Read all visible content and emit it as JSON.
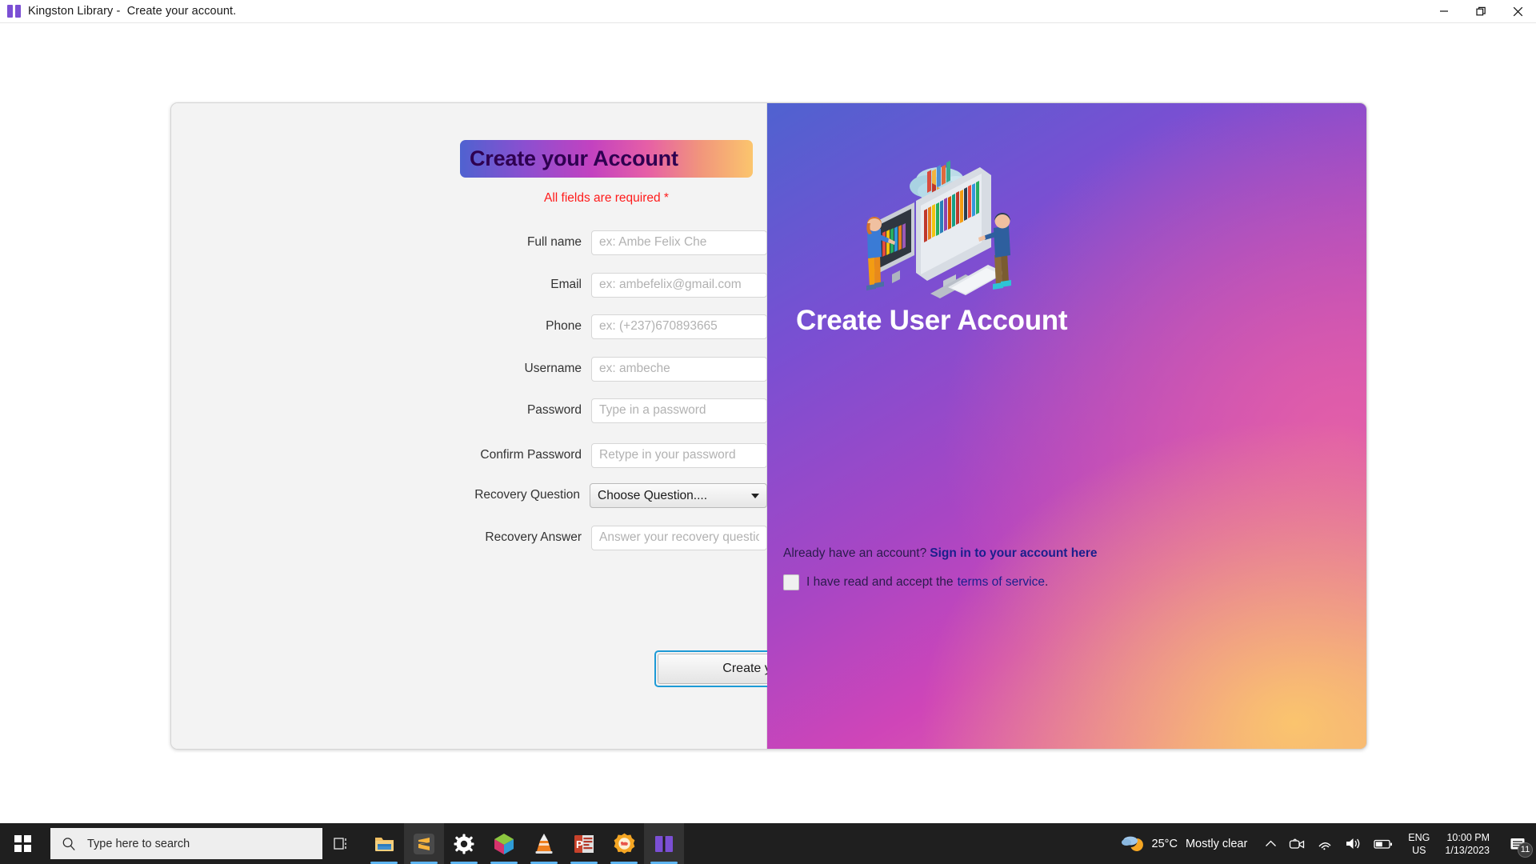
{
  "window": {
    "title": "Kingston Library -  Create your account.",
    "icon": "book-icon",
    "minimize_label": "Minimize",
    "maximize_label": "Restore",
    "close_label": "Close"
  },
  "form": {
    "heading": "Create your Account",
    "required_note": "All fields are required *",
    "fields": [
      {
        "label": "Full name",
        "placeholder": "ex: Ambe Felix Che",
        "value": "",
        "type": "text"
      },
      {
        "label": "Email",
        "placeholder": "ex: ambefelix@gmail.com",
        "value": "",
        "type": "email"
      },
      {
        "label": "Phone",
        "placeholder": "ex: (+237)670893665",
        "value": "",
        "type": "tel"
      },
      {
        "label": "Username",
        "placeholder": "ex: ambeche",
        "value": "",
        "type": "text"
      },
      {
        "label": "Password",
        "placeholder": "Type in a password",
        "value": "",
        "type": "password"
      },
      {
        "label": "Confirm Password",
        "placeholder": "Retype in your password",
        "value": "",
        "type": "password"
      }
    ],
    "recovery_question": {
      "label": "Recovery Question",
      "selected": "Choose Question....",
      "options": [
        "Choose Question...."
      ]
    },
    "recovery_answer": {
      "label": "Recovery Answer",
      "placeholder": "Answer your recovery question",
      "value": ""
    },
    "submit_label": "Create your Account."
  },
  "hero": {
    "heading": "Create User Account",
    "signin_prompt": "Already have an account?",
    "signin_link": "Sign in to your account here",
    "terms_prefix": "I have read and accept the",
    "terms_link": "terms of service",
    "terms_suffix": ".",
    "terms_checked": false,
    "illustration": "isometric-digital-library-illustration"
  },
  "taskbar": {
    "start_label": "Start",
    "search_placeholder": "Type here to search",
    "task_view_label": "Task View",
    "apps": [
      {
        "name": "file-explorer",
        "label": "File Explorer",
        "active": false,
        "running": true
      },
      {
        "name": "sublime-text",
        "label": "Sublime Text",
        "active": true,
        "running": true
      },
      {
        "name": "settings",
        "label": "Settings",
        "active": false,
        "running": true
      },
      {
        "name": "cube-app",
        "label": "Cube App",
        "active": false,
        "running": true
      },
      {
        "name": "vlc",
        "label": "VLC Media Player",
        "active": false,
        "running": true
      },
      {
        "name": "powerpoint",
        "label": "PowerPoint",
        "active": false,
        "running": true
      },
      {
        "name": "orange-app",
        "label": "Orange App",
        "active": false,
        "running": true
      },
      {
        "name": "kingston-library",
        "label": "Kingston Library",
        "active": true,
        "running": true
      }
    ],
    "tray": {
      "temperature": "25°C",
      "condition": "Mostly clear",
      "language_top": "ENG",
      "language_bottom": "US",
      "time": "10:00 PM",
      "date": "1/13/2023",
      "notification_count": "11"
    }
  },
  "colors": {
    "accent_blue": "#1d9ad6",
    "required_red": "#ff1a1a",
    "link_blue": "#1a1f8c",
    "gradient_start": "#4f62d0",
    "gradient_mid": "#cf45b8",
    "gradient_end": "#fbc56d",
    "taskbar_bg": "#1f1f1f"
  }
}
